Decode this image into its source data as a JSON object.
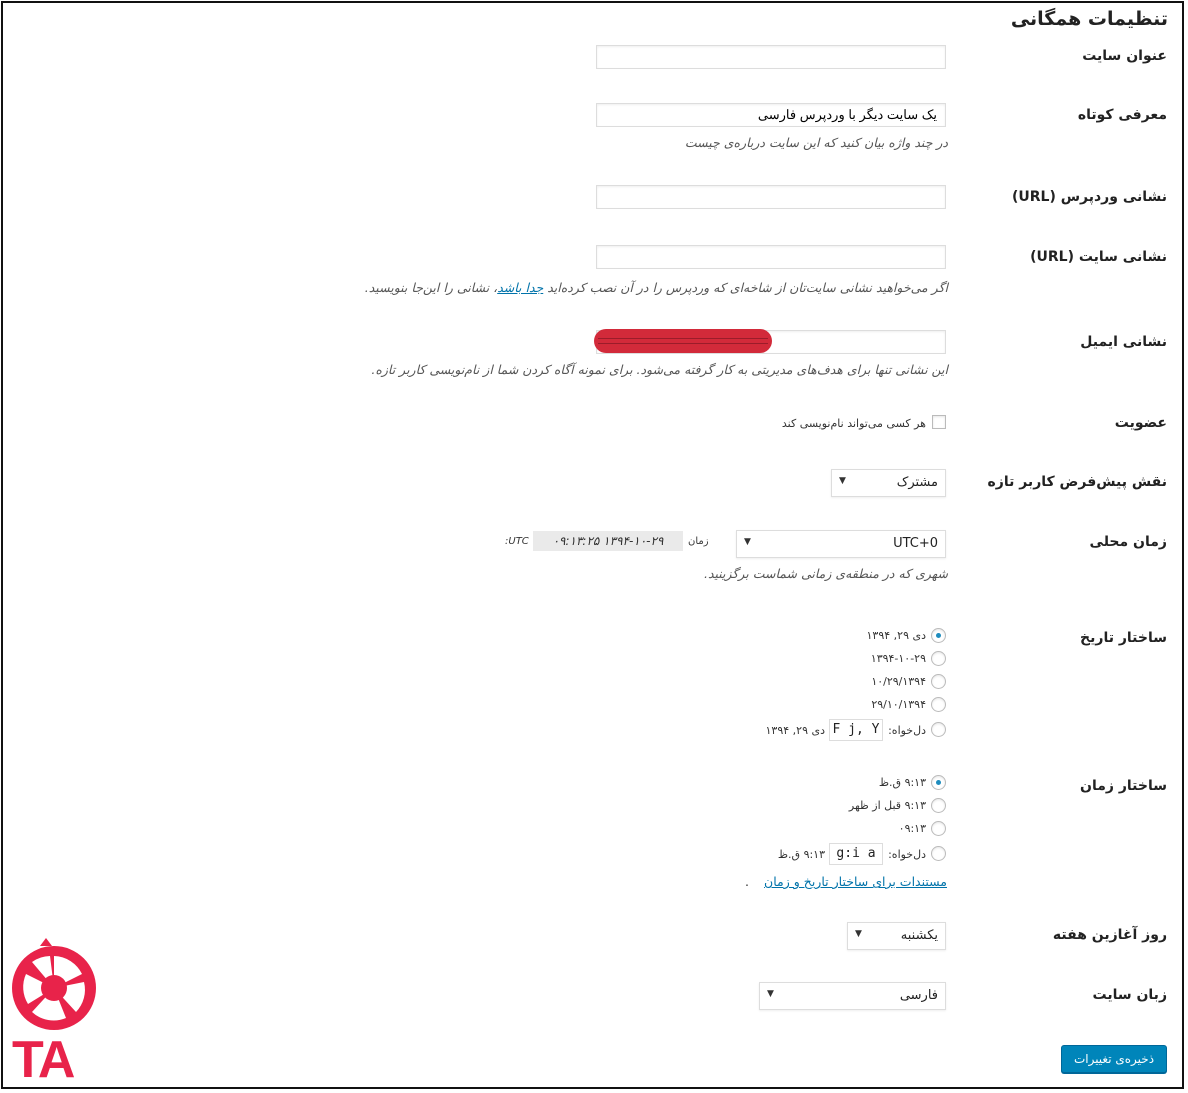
{
  "page": {
    "title": "تنظیمات همگانی"
  },
  "fields": {
    "site_title": {
      "label": "عنوان سایت",
      "value": ""
    },
    "tagline": {
      "label": "معرفی کوتاه",
      "value": "یک سایت دیگر با وردپرس فارسی",
      "description": "در چند واژه بیان کنید که این سایت درباره‌ی چیست"
    },
    "wp_url": {
      "label": "نشانی وردپرس (URL)",
      "value": ""
    },
    "site_url": {
      "label": "نشانی سایت (URL)",
      "value": "",
      "description_before": "اگر می‌خواهید نشانی سایت‌تان از شاخه‌ای که وردپرس را در آن نصب کرده‌اید ",
      "description_link": "جدا باشد",
      "description_after": "، نشانی را این‌جا بنویسید."
    },
    "email": {
      "label": "نشانی ایمیل",
      "value": "",
      "description": "این نشانی تنها برای هدف‌های مدیریتی به کار گرفته می‌شود. برای نمونه آگاه کردن شما از نام‌نویسی کاربر تازه."
    },
    "membership": {
      "label": "عضویت",
      "checkbox_label": "هر کسی می‌تواند نام‌نویسی کند",
      "checked": false
    },
    "default_role": {
      "label": "نقش پیش‌فرض کاربر تازه",
      "selected": "مشترک"
    },
    "timezone": {
      "label": "زمان محلی",
      "selected": "UTC+0",
      "time_label": "زمان",
      "utc_time": "۱۳۹۴-۱۰-۲۹ ۰۹:۱۳:۲۵",
      "utc_label": "UTC:",
      "description": "شهری که در منطقه‌ی زمانی شماست برگزینید."
    },
    "date_format": {
      "label": "ساختار تاریخ",
      "options": [
        "دی ۲۹, ۱۳۹۴",
        "۱۳۹۴-۱۰-۲۹",
        "۱۰/۲۹/۱۳۹۴",
        "۲۹/۱۰/۱۳۹۴"
      ],
      "selected_index": 0,
      "custom_label": "دل‌خواه:",
      "custom_value": "F j, Y",
      "custom_preview": "دی ۲۹, ۱۳۹۴"
    },
    "time_format": {
      "label": "ساختار زمان",
      "options": [
        "۹:۱۳ ق.ظ",
        "۹:۱۳ قبل از ظهر",
        "۰۹:۱۳"
      ],
      "selected_index": 0,
      "custom_label": "دل‌خواه:",
      "custom_value": "g:i a",
      "custom_preview": "۹:۱۳ ق.ظ",
      "doc_link": "مستندات برای ساختار تاریخ و زمان",
      "doc_link_suffix": "."
    },
    "week_start": {
      "label": "روز آغازین هفته",
      "selected": "یکشنبه"
    },
    "site_language": {
      "label": "زبان سایت",
      "selected": "فارسی"
    }
  },
  "save_button": "ذخیره‌ی تغییرات",
  "logo": {
    "text": "TA",
    "color": "#e8234a"
  },
  "colors": {
    "accent": "#0085ba",
    "link": "#0073aa",
    "radio": "#1e8cbe",
    "redaction": "#d22a3a"
  }
}
